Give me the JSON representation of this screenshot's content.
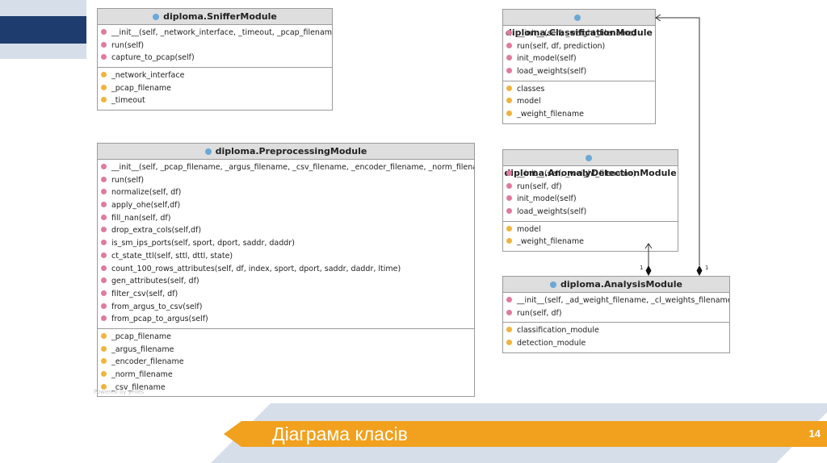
{
  "classes": {
    "sniffer": {
      "name": "diploma.SnifferModule",
      "methods": [
        "__init__(self, _network_interface, _timeout, _pcap_filename)",
        "run(self)",
        "capture_to_pcap(self)"
      ],
      "fields": [
        "_network_interface",
        "_pcap_filename",
        "_timeout"
      ]
    },
    "preprocessing": {
      "name": "diploma.PreprocessingModule",
      "methods": [
        "__init__(self, _pcap_filename, _argus_filename, _csv_filename, _encoder_filename, _norm_filename)",
        "run(self)",
        "normalize(self, df)",
        "apply_ohe(self,df)",
        "fill_nan(self, df)",
        "drop_extra_cols(self,df)",
        "is_sm_ips_ports(self, sport, dport, saddr, daddr)",
        "ct_state_ttl(self, sttl, dttl, state)",
        "count_100_rows_attributes(self, df, index, sport, dport, saddr, daddr, ltime)",
        "gen_attributes(self, df)",
        "filter_csv(self, df)",
        "from_argus_to_csv(self)",
        "from_pcap_to_argus(self)"
      ],
      "fields": [
        "_pcap_filename",
        "_argus_filename",
        "_encoder_filename",
        "_norm_filename",
        "_csv_filename"
      ]
    },
    "classification": {
      "name": "diploma.ClassificationModule",
      "methods": [
        "__init__(self, _weight_filename)",
        "run(self, df, prediction)",
        "init_model(self)",
        "load_weights(self)"
      ],
      "fields": [
        "classes",
        "model",
        "_weight_filename"
      ]
    },
    "anomaly": {
      "name": "diploma.AnomalyDetectionModule",
      "methods": [
        "__init__(self, _weight_filename)",
        "run(self, df)",
        "init_model(self)",
        "load_weights(self)"
      ],
      "fields": [
        "model",
        "_weight_filename"
      ]
    },
    "analysis": {
      "name": "diploma.AnalysisModule",
      "methods": [
        "__init__(self, _ad_weight_filename, _cl_weights_filename)",
        "run(self, df)"
      ],
      "fields": [
        "classification_module",
        "detection_module"
      ]
    }
  },
  "relations": {
    "analysis_to_anomaly_multiplicity": "1",
    "analysis_to_classification_multiplicity": "1"
  },
  "watermark": "Powered by yFiles",
  "slide": {
    "title": "Діаграма класів",
    "page_number": "14"
  },
  "colors": {
    "navy": "#1e3c6e",
    "light_blue": "#d6deea",
    "orange": "#f1a11e",
    "method_icon": "#e07aa0",
    "field_icon": "#f0b43c",
    "class_icon": "#6aa9d6"
  }
}
